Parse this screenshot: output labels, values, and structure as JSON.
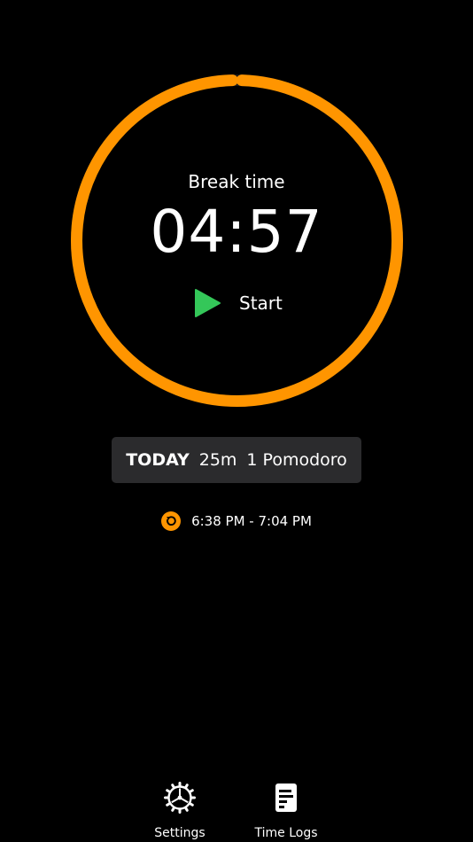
{
  "colors": {
    "accent": "#ff9500",
    "play": "#34c759",
    "background": "#000000",
    "summary_bg": "#2b2b2d",
    "text": "#ffffff"
  },
  "timer": {
    "session_label": "Break time",
    "remaining": "04:57",
    "progress_fraction": 0.99,
    "start_label": "Start",
    "start_icon": "play-icon"
  },
  "today": {
    "label": "TODAY",
    "duration": "25m",
    "pomodoros": "1 Pomodoro"
  },
  "history": [
    {
      "icon": "history-icon",
      "time_range": "6:38 PM - 7:04 PM"
    }
  ],
  "tabs": {
    "settings": {
      "label": "Settings",
      "icon": "gear-icon"
    },
    "time_logs": {
      "label": "Time Logs",
      "icon": "document-icon"
    }
  }
}
